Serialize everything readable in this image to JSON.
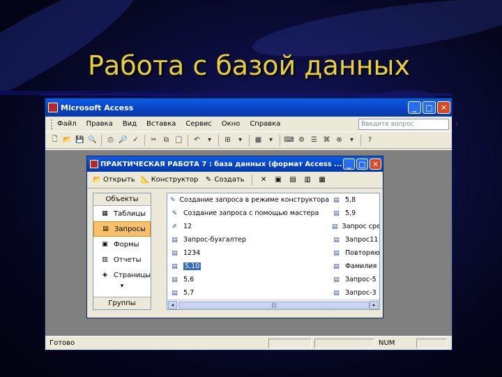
{
  "slide": {
    "title": "Работа с базой данных"
  },
  "access": {
    "title": "Microsoft Access",
    "menu": [
      "Файл",
      "Правка",
      "Вид",
      "Вставка",
      "Сервис",
      "Окно",
      "Справка"
    ],
    "help_placeholder": "Введите вопрос",
    "status": {
      "left": "Готово",
      "num": "NUM"
    }
  },
  "db": {
    "title": "ПРАКТИЧЕСКАЯ РАБОТА 7 : база данных (формат Access ...",
    "toolbar": {
      "open": "Открыть",
      "design": "Конструктор",
      "create": "Создать"
    },
    "objects_header": "Объекты",
    "objects": [
      "Таблицы",
      "Запросы",
      "Формы",
      "Отчеты",
      "Страницы"
    ],
    "groups": "Группы",
    "col1": [
      "Создание запроса в режиме конструктора",
      "Создание запроса с помощью мастера",
      "12",
      "Запрос-бухгалтер",
      "1234",
      "5,10",
      "5,6",
      "5,7"
    ],
    "col2": [
      "5,8",
      "5,9",
      "Запрос сред",
      "Запрос11",
      "Повторяю",
      "Фамилия",
      "Запрос-5",
      "Запрос-3"
    ]
  }
}
